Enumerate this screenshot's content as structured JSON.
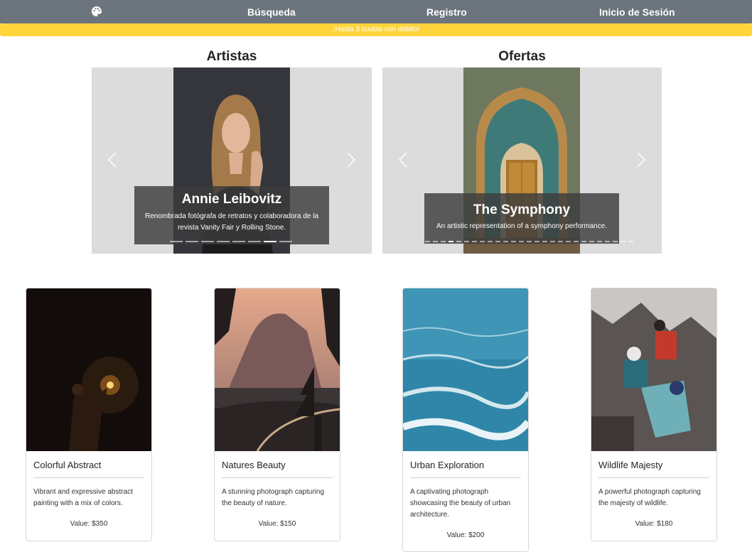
{
  "navbar": {
    "logo_icon": "palette-icon",
    "links": [
      "Búsqueda",
      "Registro",
      "Inicio de Sesión"
    ]
  },
  "promo_banner": "¡Hasta 3 cuotas con débito!",
  "sections": {
    "artists_title": "Artistas",
    "offers_title": "Ofertas"
  },
  "artists_carousel": {
    "caption_title": "Annie Leibovitz",
    "caption_text": "Renombrada fotógrafa de retratos y colaboradora de la revista Vanity Fair y Rolling Stone.",
    "slide_count": 8,
    "active_slide": 7
  },
  "offers_carousel": {
    "caption_title": "The Symphony",
    "caption_text": "An artistic representation of a symphony performance.",
    "slide_count": 27,
    "active_slide": 4
  },
  "cards": [
    {
      "title": "Colorful Abstract",
      "description": "Vibrant and expressive abstract painting with a mix of colors.",
      "value": "Value: $350"
    },
    {
      "title": "Natures Beauty",
      "description": "A stunning photograph capturing the beauty of nature.",
      "value": "Value: $150"
    },
    {
      "title": "Urban Exploration",
      "description": "A captivating photograph showcasing the beauty of urban architecture.",
      "value": "Value: $200"
    },
    {
      "title": "Wildlife Majesty",
      "description": "A powerful photograph capturing the majesty of wildlife.",
      "value": "Value: $180"
    }
  ],
  "colors": {
    "navbar": "#6c757d",
    "promo": "#ffd43b",
    "carousel_bg": "#dcdcdc"
  }
}
